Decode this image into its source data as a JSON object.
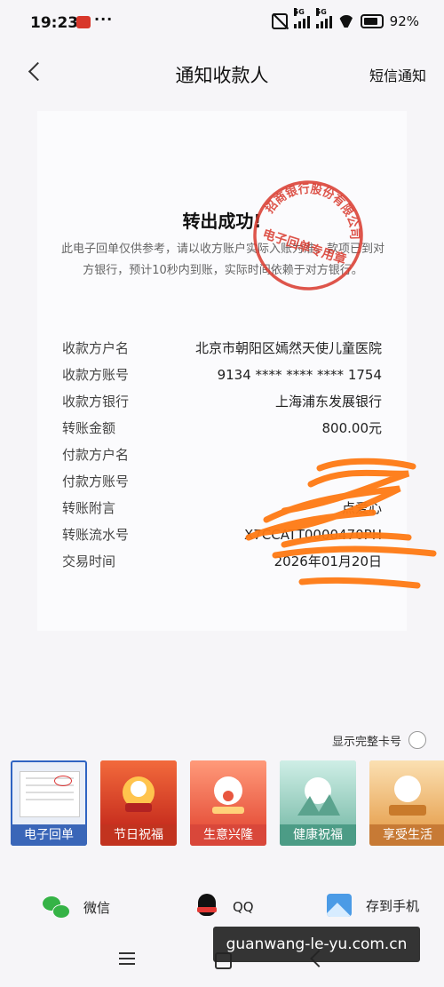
{
  "status_bar": {
    "time": "19:23",
    "more": "···",
    "signal_1": "5G",
    "signal_2": "5G",
    "battery": "92%"
  },
  "nav": {
    "title": "通知收款人",
    "right_action": "短信通知"
  },
  "receipt": {
    "headline": "转出成功!",
    "note": "此电子回单仅供参考，请以收方账户实际入账为准。款项已到对方银行，预计10秒内到账，实际时间依赖于对方银行。",
    "stamp_top": "招商银行股份有限公司",
    "stamp_bottom": "电子回单专用章",
    "rows": [
      {
        "label": "收款方户名",
        "value": "北京市朝阳区嫣然天使儿童医院"
      },
      {
        "label": "收款方账号",
        "value": "9134 **** **** **** 1754"
      },
      {
        "label": "收款方银行",
        "value": "上海浦东发展银行"
      },
      {
        "label": "转账金额",
        "value": "800.00元"
      },
      {
        "label": "付款方户名",
        "value": ""
      },
      {
        "label": "付款方账号",
        "value": ""
      },
      {
        "label": "转账附言",
        "value": "点爱心"
      },
      {
        "label": "转账流水号",
        "value": "X7CCATT0000470PH"
      },
      {
        "label": "交易时间",
        "value": "2026年01月20日"
      }
    ]
  },
  "options": {
    "show_full_card": "显示完整卡号"
  },
  "templates": [
    {
      "label": "电子回单"
    },
    {
      "label": "节日祝福"
    },
    {
      "label": "生意兴隆"
    },
    {
      "label": "健康祝福"
    },
    {
      "label": "享受生活"
    }
  ],
  "share": {
    "wechat": "微信",
    "qq": "QQ",
    "save": "存到手机"
  },
  "watermark": "guanwang-le-yu.com.cn",
  "colors": {
    "stamp_red": "#d8372b",
    "scribble_orange": "#ff7a14",
    "selected_border": "#2f64c2"
  }
}
